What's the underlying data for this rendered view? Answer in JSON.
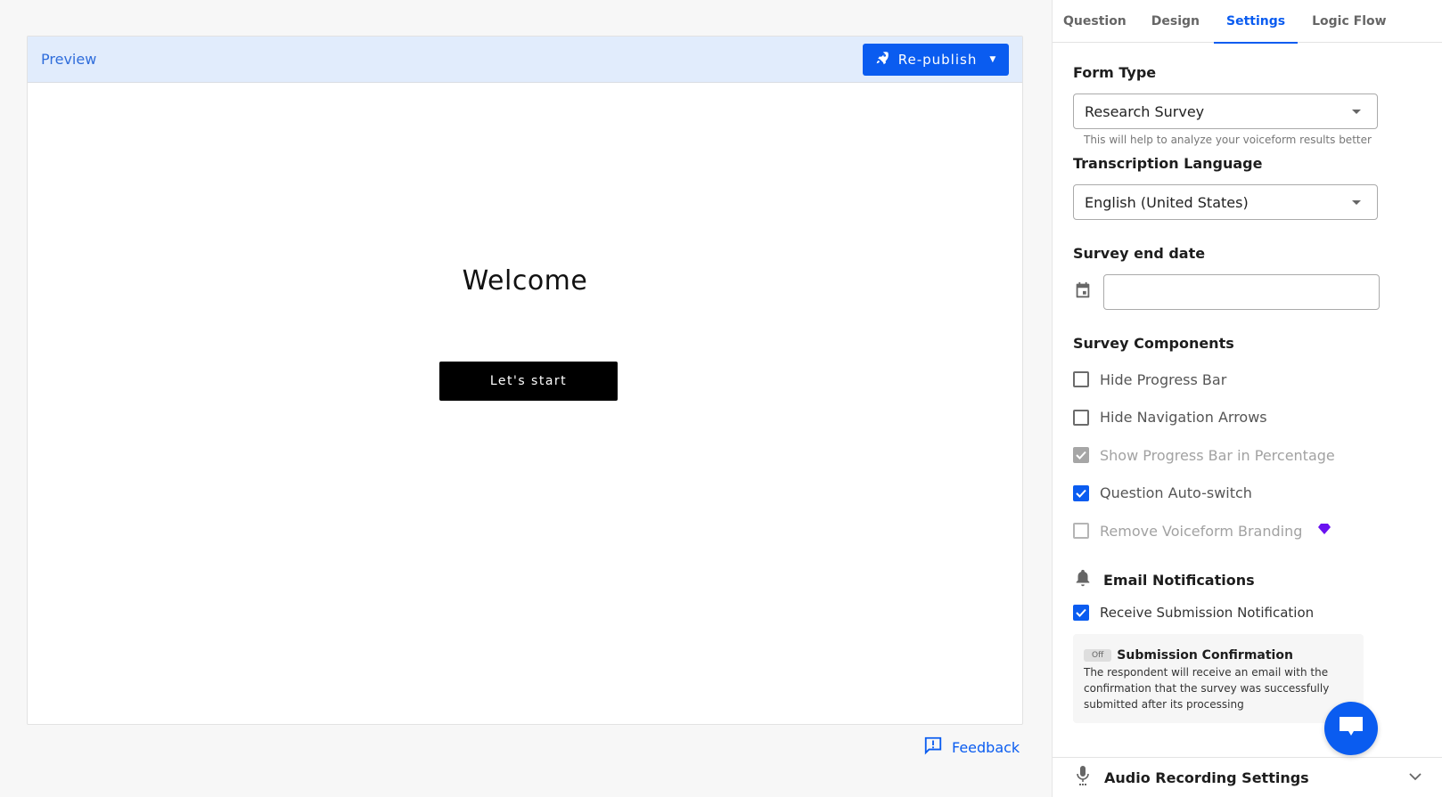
{
  "preview": {
    "title": "Preview",
    "republish_label": "Re-publish",
    "welcome_title": "Welcome",
    "start_label": "Let's start",
    "feedback_label": "Feedback"
  },
  "tabs": [
    {
      "label": "Question",
      "active": false
    },
    {
      "label": "Design",
      "active": false
    },
    {
      "label": "Settings",
      "active": true
    },
    {
      "label": "Logic Flow",
      "active": false
    }
  ],
  "settings": {
    "form_type": {
      "label": "Form Type",
      "value": "Research Survey",
      "hint": "This will help to analyze your voiceform results better"
    },
    "transcription": {
      "label": "Transcription Language",
      "value": "English (United States)"
    },
    "end_date": {
      "label": "Survey end date",
      "value": ""
    },
    "components": {
      "label": "Survey Components",
      "items": [
        {
          "label": "Hide Progress Bar",
          "checked": false,
          "disabled": false
        },
        {
          "label": "Hide Navigation Arrows",
          "checked": false,
          "disabled": false
        },
        {
          "label": "Show Progress Bar in Percentage",
          "checked": true,
          "disabled": true
        },
        {
          "label": "Question Auto-switch",
          "checked": true,
          "disabled": false
        },
        {
          "label": "Remove Voiceform Branding",
          "checked": false,
          "disabled": true,
          "premium": true
        }
      ]
    },
    "email": {
      "label": "Email Notifications",
      "receive_label": "Receive Submission Notification",
      "receive_checked": true,
      "confirmation": {
        "toggle_label": "Off",
        "title": "Submission Confirmation",
        "description": "The respondent will receive an email with the confirmation that the survey was successfully submitted after its processing"
      }
    },
    "audio": {
      "label": "Audio Recording Settings"
    }
  },
  "colors": {
    "accent": "#0a5cf0",
    "premium": "#6a12f0",
    "preview_header_bg": "#e1ecfc"
  }
}
